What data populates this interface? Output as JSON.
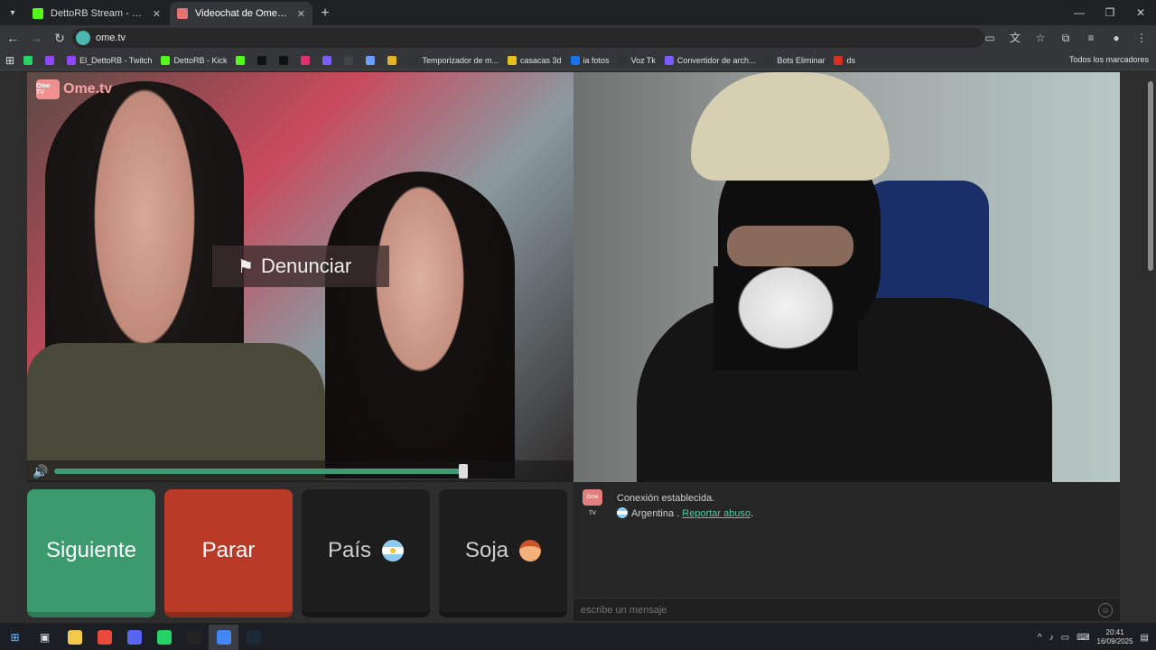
{
  "browser": {
    "tabs": [
      {
        "title": "DettoRB Stream - Watch Live o",
        "close": "✕",
        "color": "#53fc18"
      },
      {
        "title": "Videochat de OmeTV: una",
        "close": "✕",
        "color": "#e57373"
      }
    ],
    "new_tab": "+",
    "url": "ome.tv",
    "bookmarks": [
      {
        "label": "",
        "color": "#25d366"
      },
      {
        "label": "",
        "color": "#9146ff"
      },
      {
        "label": "El_DettoRB - Twitch",
        "color": "#9146ff"
      },
      {
        "label": "DettoRB - Kick",
        "color": "#53fc18"
      },
      {
        "label": "",
        "color": "#53fc18"
      },
      {
        "label": "",
        "color": "#111111"
      },
      {
        "label": "",
        "color": "#111111"
      },
      {
        "label": "",
        "color": "#e1306c"
      },
      {
        "label": "",
        "color": "#7b5cff"
      },
      {
        "label": "",
        "color": "#444444"
      },
      {
        "label": "",
        "color": "#6aa0ff"
      },
      {
        "label": "",
        "color": "#e6b422"
      },
      {
        "label": "Temporizador de m...",
        "color": "#333333"
      },
      {
        "label": "casacas 3d",
        "color": "#e6c01b"
      },
      {
        "label": "ia fotos",
        "color": "#1a73e8"
      },
      {
        "label": "Voz Tk",
        "color": "#333333"
      },
      {
        "label": "Convertidor de arch...",
        "color": "#7b5cff"
      },
      {
        "label": "Bots Eliminar",
        "color": "#333333"
      },
      {
        "label": "ds",
        "color": "#d93025"
      }
    ],
    "all_bookmarks": "Todos los marcadores"
  },
  "left_video": {
    "logo_text": "Ome.tv",
    "logo_badge": "Ome TV",
    "report_label": "Denunciar",
    "volume_level": 0.99
  },
  "controls": {
    "next_label": "Siguiente",
    "stop_label": "Parar",
    "country_label": "País",
    "gender_label": "Soja"
  },
  "chat": {
    "badge": "Ome TV",
    "status": "Conexión establecida.",
    "country": "Argentina",
    "separator": " . ",
    "report_link": "Reportar abuso",
    "end": ".",
    "placeholder": "escribe un mensaje"
  },
  "taskbar": {
    "time": "20:41",
    "date": "16/09/2025",
    "app_colors": [
      "#f2c94c",
      "#e84a3c",
      "#5865f2",
      "#25d366",
      "#222222",
      "#4285f4",
      "#1b2838"
    ]
  },
  "colors": {
    "accent_green": "#3b9a6e",
    "stop_red": "#b83a27",
    "link": "#5fc3a0"
  }
}
